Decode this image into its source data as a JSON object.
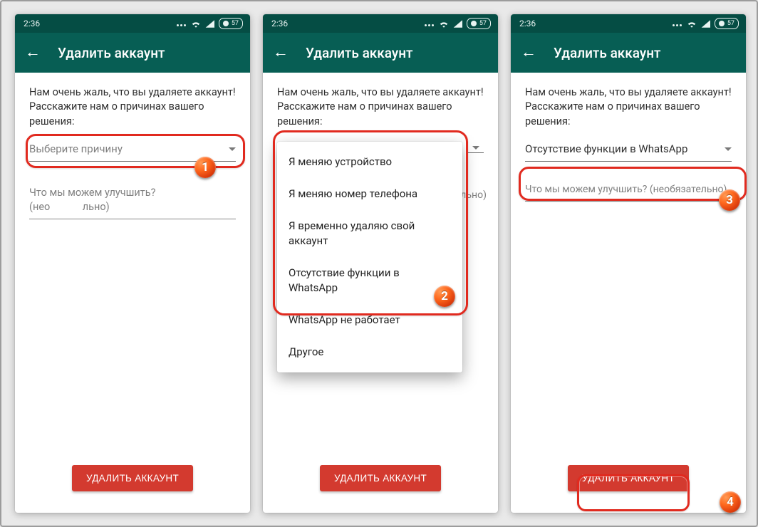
{
  "statusbar": {
    "time": "2:36",
    "battery": "57"
  },
  "appbar": {
    "title": "Удалить аккаунт"
  },
  "intro_text": "Нам очень жаль, что вы удаляете аккаунт! Расскажите нам о причинах вашего решения:",
  "screen1": {
    "reason_placeholder": "Выберите причину",
    "improve_placeholder_visible": "Что мы можем улучшить? (нео",
    "improve_placeholder_tail": "льно)"
  },
  "screen2": {
    "options": [
      "Я меняю устройство",
      "Я меняю номер телефона",
      "Я временно удаляю свой аккаунт",
      "Отсутствие функции в WhatsApp",
      "WhatsApp не работает",
      "Другое"
    ],
    "tail_hint": "льно)"
  },
  "screen3": {
    "selected_reason": "Отсутствие функции в WhatsApp",
    "improve_placeholder": "Что мы можем улучшить? (необязательно)"
  },
  "delete_button_label": "УДАЛИТЬ АККАУНТ",
  "badges": {
    "b1": "1",
    "b2": "2",
    "b3": "3",
    "b4": "4"
  }
}
